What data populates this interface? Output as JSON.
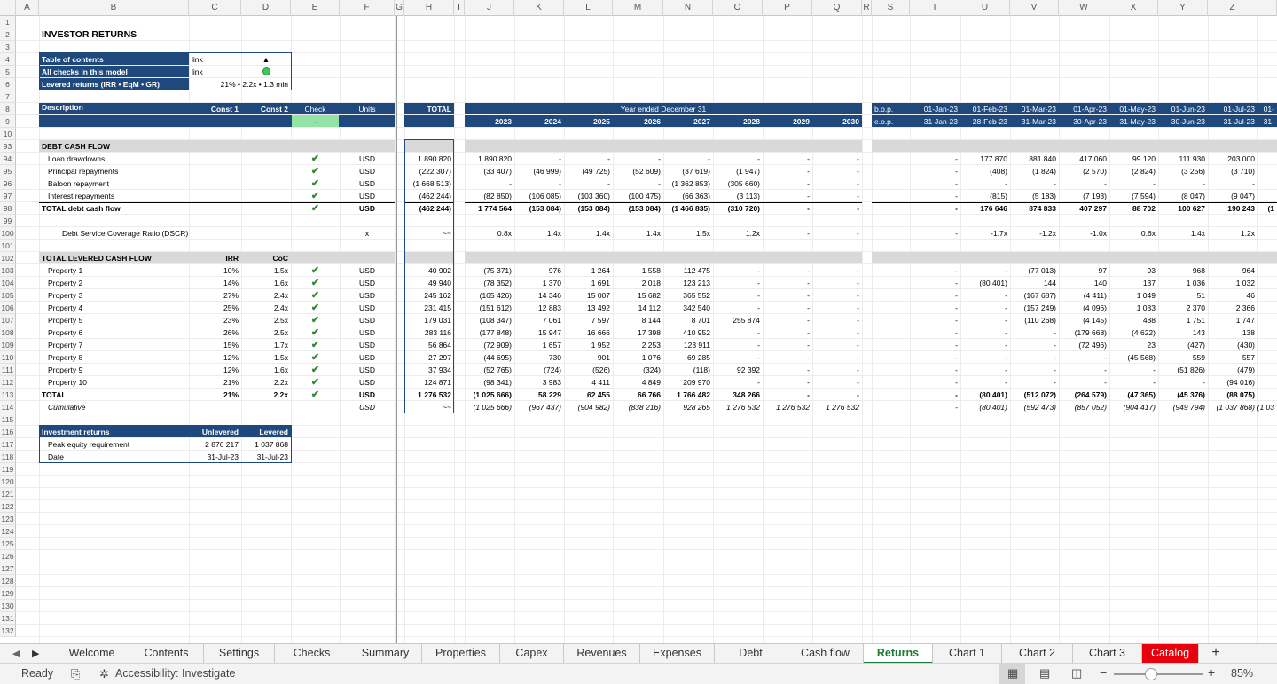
{
  "columns": [
    "A",
    "B",
    "C",
    "D",
    "E",
    "F",
    "G",
    "H",
    "I",
    "J",
    "K",
    "L",
    "M",
    "N",
    "O",
    "P",
    "Q",
    "R",
    "S",
    "T",
    "U",
    "V",
    "W",
    "X",
    "Y",
    "Z"
  ],
  "rows": [
    "1",
    "2",
    "3",
    "4",
    "5",
    "6",
    "7",
    "8",
    "9",
    "10",
    "93",
    "94",
    "95",
    "96",
    "97",
    "98",
    "99",
    "100",
    "101",
    "102",
    "103",
    "104",
    "105",
    "106",
    "107",
    "108",
    "109",
    "110",
    "111",
    "112",
    "113",
    "114",
    "115",
    "116",
    "117",
    "118",
    "119",
    "120",
    "121",
    "122",
    "123",
    "124",
    "125",
    "126",
    "127",
    "128",
    "129",
    "130",
    "131",
    "132"
  ],
  "title": "INVESTOR RETURNS",
  "toc": {
    "label1": "Table of contents",
    "val1": "link",
    "icon1": "▲",
    "label2": "All checks in this model",
    "val2": "link",
    "label3": "Levered returns (IRR • EqM • GR)",
    "val3": "21% • 2.2x • 1.3 mln"
  },
  "header": {
    "description": "Description",
    "const1": "Const 1",
    "const2": "Const 2",
    "check": "Check",
    "check_val": "-",
    "units": "Units",
    "total": "TOTAL",
    "year_ended": "Year ended December 31",
    "bop": "b.o.p.",
    "eop": "e.o.p.",
    "years": [
      "2023",
      "2024",
      "2025",
      "2026",
      "2027",
      "2028",
      "2029",
      "2030"
    ],
    "months_bop": [
      "01-Jan-23",
      "01-Feb-23",
      "01-Mar-23",
      "01-Apr-23",
      "01-May-23",
      "01-Jun-23",
      "01-Jul-23",
      "01-"
    ],
    "months_eop": [
      "31-Jan-23",
      "28-Feb-23",
      "31-Mar-23",
      "30-Apr-23",
      "31-May-23",
      "30-Jun-23",
      "31-Jul-23",
      "31-"
    ]
  },
  "debt": {
    "section": "DEBT CASH FLOW",
    "rows": [
      {
        "label": "Loan drawdowns",
        "units": "USD",
        "total": "1 890 820",
        "years": [
          "1 890 820",
          "-",
          "-",
          "-",
          "-",
          "-",
          "-",
          "-"
        ],
        "months": [
          "-",
          "177 870",
          "881 840",
          "417 060",
          "99 120",
          "111 930",
          "203 000",
          ""
        ]
      },
      {
        "label": "Principal repayments",
        "units": "USD",
        "total": "(222 307)",
        "years": [
          "(33 407)",
          "(46 999)",
          "(49 725)",
          "(52 609)",
          "(37 619)",
          "(1 947)",
          "-",
          "-"
        ],
        "months": [
          "-",
          "(408)",
          "(1 824)",
          "(2 570)",
          "(2 824)",
          "(3 256)",
          "(3 710)",
          ""
        ]
      },
      {
        "label": "Baloon repayment",
        "units": "USD",
        "total": "(1 668 513)",
        "years": [
          "-",
          "-",
          "-",
          "-",
          "(1 362 853)",
          "(305 660)",
          "-",
          "-"
        ],
        "months": [
          "-",
          "-",
          "-",
          "-",
          "-",
          "-",
          "-",
          ""
        ]
      },
      {
        "label": "Interest repayments",
        "units": "USD",
        "total": "(462 244)",
        "years": [
          "(82 850)",
          "(106 085)",
          "(103 360)",
          "(100 475)",
          "(66 363)",
          "(3 113)",
          "-",
          "-"
        ],
        "months": [
          "-",
          "(815)",
          "(5 183)",
          "(7 193)",
          "(7 594)",
          "(8 047)",
          "(9 047)",
          ""
        ]
      },
      {
        "label": "TOTAL debt cash flow",
        "units": "USD",
        "total": "(462 244)",
        "years": [
          "1 774 564",
          "(153 084)",
          "(153 084)",
          "(153 084)",
          "(1 466 835)",
          "(310 720)",
          "-",
          "-"
        ],
        "months": [
          "-",
          "176 646",
          "874 833",
          "407 297",
          "88 702",
          "100 627",
          "190 243",
          "(1"
        ]
      }
    ],
    "dscr": {
      "label": "Debt Service Coverage Ratio (DSCR)",
      "units": "x",
      "total": "~~",
      "years": [
        "0.8x",
        "1.4x",
        "1.4x",
        "1.4x",
        "1.5x",
        "1.2x",
        "-",
        "-"
      ],
      "months": [
        "-",
        "-1.7x",
        "-1.2x",
        "-1.0x",
        "0.6x",
        "1.4x",
        "1.2x",
        ""
      ]
    }
  },
  "levered": {
    "section": "TOTAL LEVERED CASH FLOW",
    "irr": "IRR",
    "coc": "CoC",
    "rows": [
      {
        "label": "Property 1",
        "irr": "10%",
        "coc": "1.5x",
        "units": "USD",
        "total": "40 902",
        "years": [
          "(75 371)",
          "976",
          "1 264",
          "1 558",
          "112 475",
          "-",
          "-",
          "-"
        ],
        "months": [
          "-",
          "-",
          "(77 013)",
          "97",
          "93",
          "968",
          "964",
          ""
        ]
      },
      {
        "label": "Property 2",
        "irr": "14%",
        "coc": "1.6x",
        "units": "USD",
        "total": "49 940",
        "years": [
          "(78 352)",
          "1 370",
          "1 691",
          "2 018",
          "123 213",
          "-",
          "-",
          "-"
        ],
        "months": [
          "-",
          "(80 401)",
          "144",
          "140",
          "137",
          "1 036",
          "1 032",
          ""
        ]
      },
      {
        "label": "Property 3",
        "irr": "27%",
        "coc": "2.4x",
        "units": "USD",
        "total": "245 162",
        "years": [
          "(165 426)",
          "14 346",
          "15 007",
          "15 682",
          "365 552",
          "-",
          "-",
          "-"
        ],
        "months": [
          "-",
          "-",
          "(167 687)",
          "(4 411)",
          "1 049",
          "51",
          "46",
          ""
        ]
      },
      {
        "label": "Property 4",
        "irr": "25%",
        "coc": "2.4x",
        "units": "USD",
        "total": "231 415",
        "years": [
          "(151 612)",
          "12 883",
          "13 492",
          "14 112",
          "342 540",
          "-",
          "-",
          "-"
        ],
        "months": [
          "-",
          "-",
          "(157 249)",
          "(4 096)",
          "1 033",
          "2 370",
          "2 366",
          ""
        ]
      },
      {
        "label": "Property 5",
        "irr": "23%",
        "coc": "2.5x",
        "units": "USD",
        "total": "179 031",
        "years": [
          "(108 347)",
          "7 061",
          "7 597",
          "8 144",
          "8 701",
          "255 874",
          "-",
          "-"
        ],
        "months": [
          "-",
          "-",
          "(110 268)",
          "(4 145)",
          "488",
          "1 751",
          "1 747",
          ""
        ]
      },
      {
        "label": "Property 6",
        "irr": "26%",
        "coc": "2.5x",
        "units": "USD",
        "total": "283 116",
        "years": [
          "(177 848)",
          "15 947",
          "16 666",
          "17 398",
          "410 952",
          "-",
          "-",
          "-"
        ],
        "months": [
          "-",
          "-",
          "-",
          "(179 668)",
          "(4 622)",
          "143",
          "138",
          ""
        ]
      },
      {
        "label": "Property 7",
        "irr": "15%",
        "coc": "1.7x",
        "units": "USD",
        "total": "56 864",
        "years": [
          "(72 909)",
          "1 657",
          "1 952",
          "2 253",
          "123 911",
          "-",
          "-",
          "-"
        ],
        "months": [
          "-",
          "-",
          "-",
          "(72 496)",
          "23",
          "(427)",
          "(430)",
          ""
        ]
      },
      {
        "label": "Property 8",
        "irr": "12%",
        "coc": "1.5x",
        "units": "USD",
        "total": "27 297",
        "years": [
          "(44 695)",
          "730",
          "901",
          "1 076",
          "69 285",
          "-",
          "-",
          "-"
        ],
        "months": [
          "-",
          "-",
          "-",
          "-",
          "(45 568)",
          "559",
          "557",
          ""
        ]
      },
      {
        "label": "Property 9",
        "irr": "12%",
        "coc": "1.6x",
        "units": "USD",
        "total": "37 934",
        "years": [
          "(52 765)",
          "(724)",
          "(526)",
          "(324)",
          "(118)",
          "92 392",
          "-",
          "-"
        ],
        "months": [
          "-",
          "-",
          "-",
          "-",
          "-",
          "(51 826)",
          "(479)",
          ""
        ]
      },
      {
        "label": "Property 10",
        "irr": "21%",
        "coc": "2.2x",
        "units": "USD",
        "total": "124 871",
        "years": [
          "(98 341)",
          "3 983",
          "4 411",
          "4 849",
          "209 970",
          "-",
          "-",
          "-"
        ],
        "months": [
          "-",
          "-",
          "-",
          "-",
          "-",
          "-",
          "(94 016)",
          ""
        ]
      }
    ],
    "total": {
      "label": "TOTAL",
      "irr": "21%",
      "coc": "2.2x",
      "units": "USD",
      "total": "1 276 532",
      "years": [
        "(1 025 666)",
        "58 229",
        "62 455",
        "66 766",
        "1 766 482",
        "348 266",
        "-",
        "-"
      ],
      "months": [
        "-",
        "(80 401)",
        "(512 072)",
        "(264 579)",
        "(47 365)",
        "(45 376)",
        "(88 075)",
        ""
      ]
    },
    "cumulative": {
      "label": "Cumulative",
      "units": "USD",
      "total": "~~",
      "years": [
        "(1 025 666)",
        "(967 437)",
        "(904 982)",
        "(838 216)",
        "928 265",
        "1 276 532",
        "1 276 532",
        "1 276 532"
      ],
      "months": [
        "-",
        "(80 401)",
        "(592 473)",
        "(857 052)",
        "(904 417)",
        "(949 794)",
        "(1 037 868)",
        "(1 03"
      ]
    }
  },
  "investment": {
    "label": "Investment returns",
    "unlevered": "Unlevered",
    "levered": "Levered",
    "row1": "Peak equity requirement",
    "row1_u": "2 876 217",
    "row1_l": "1 037 868",
    "row2": "Date",
    "row2_u": "31-Jul-23",
    "row2_l": "31-Jul-23"
  },
  "tabs": [
    "Welcome",
    "Contents",
    "Settings",
    "Checks",
    "Summary",
    "Properties",
    "Capex",
    "Revenues",
    "Expenses",
    "Debt",
    "Cash flow",
    "Returns",
    "Chart 1",
    "Chart 2",
    "Chart 3",
    "Catalog"
  ],
  "active_tab": "Returns",
  "add_sheet": "+",
  "status": {
    "ready": "Ready",
    "accessibility": "Accessibility: Investigate",
    "zoom": "85%"
  }
}
